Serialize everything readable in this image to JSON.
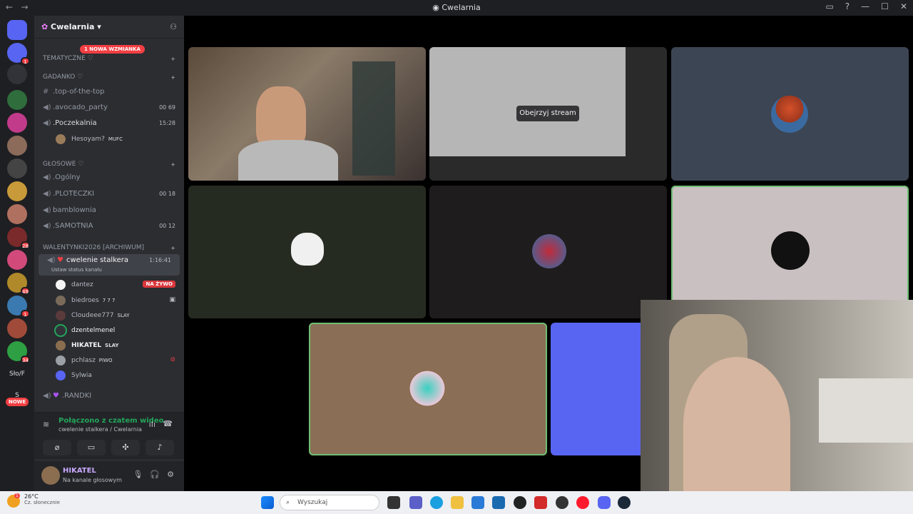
{
  "window": {
    "title": "Cwelarnia",
    "back": "←",
    "forward": "→"
  },
  "servers": {
    "nowe_label": "NOWE",
    "slof_label": "Sło/F",
    "s_label": "S",
    "badges": [
      "1",
      "28",
      "49",
      "1",
      "34"
    ]
  },
  "guild": {
    "name": "Cwelarnia",
    "mention_pill": "1 NOWA WZMIANKA",
    "categories": {
      "tematyczne": "TEMATYCZNE ♡",
      "gadanko": "GADANKO ♡",
      "glosowe": "GŁOSOWE ♡",
      "walentynki": "WALENTYNKI2026 [ARCHIWUM]"
    },
    "channels": {
      "top": ".top-of-the-top",
      "avocado": ".avocado_party",
      "avocado_count": "00 69",
      "poczekalnia": ".Poczekalnia",
      "poczekalnia_time": "15:28",
      "ogolny": ".Ogólny",
      "ploteczki": ".PLOTECZKI",
      "ploteczki_count": "00 18",
      "bamblownia": "bamblownia",
      "samotnia": ".SAMOTNIA",
      "samotnia_count": "00 12",
      "cwelenie": "cwelenie stalkera",
      "cwelenie_time": "1:16:41",
      "set_status": "Ustaw status kanału",
      "randki": ".RANDKI"
    },
    "poczekalnia_user": {
      "name": "Hesoyam?",
      "tag": "MUFC"
    },
    "voice_users": [
      {
        "name": "dantez",
        "tag": ""
      },
      {
        "name": "biedroes",
        "tag": "7 7 7"
      },
      {
        "name": "Cloudeee777",
        "tag": "SLAY"
      },
      {
        "name": "dzentelmenel",
        "tag": ""
      },
      {
        "name": "HIKATEL",
        "tag": "SLAY"
      },
      {
        "name": "pchlasz",
        "tag": "PIWO"
      },
      {
        "name": "Sylwia",
        "tag": ""
      }
    ],
    "live_label": "NA ŻYWO"
  },
  "voice_panel": {
    "connected": "Połączono z czatem wideo",
    "location": "cwelenie stalkera / Cwelarnia"
  },
  "user_panel": {
    "name": "HIKATEL",
    "status": "Na kanale głosowym"
  },
  "stage": {
    "watch_stream": "Obejrzyj stream"
  },
  "taskbar": {
    "temp": "26°C",
    "weather": "Cz. słonecznie",
    "search_placeholder": "Wyszukaj",
    "weather_badge": "1"
  },
  "colors": {
    "accent": "#5865f2",
    "green": "#23a55a",
    "speaking": "#6fbf73",
    "red": "#f23f43"
  }
}
